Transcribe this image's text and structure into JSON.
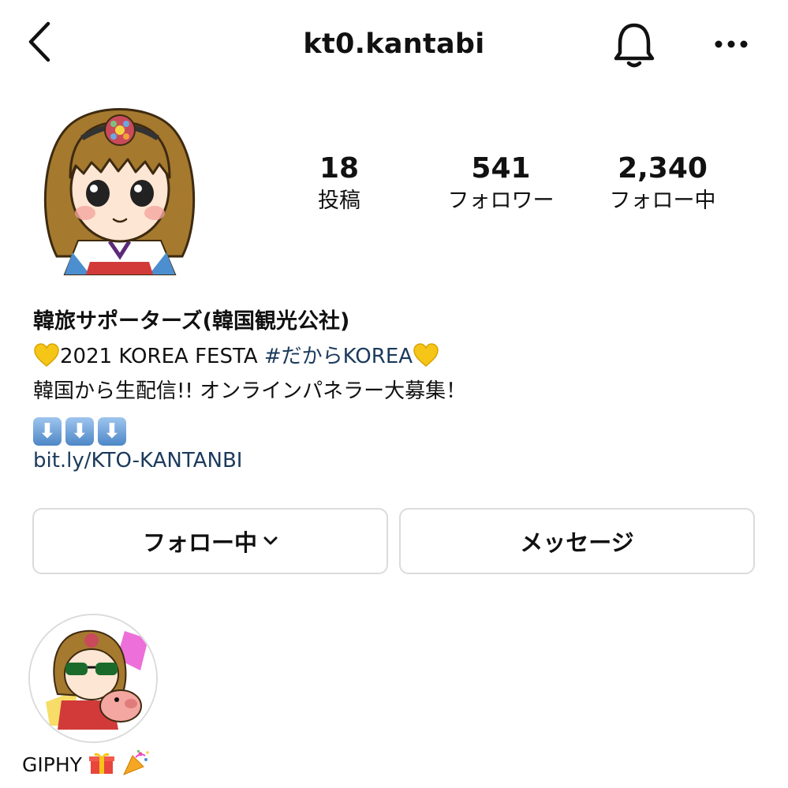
{
  "header": {
    "username": "kt0.kantabi",
    "back_icon": "chevron-left-icon",
    "bell_icon": "bell-icon",
    "more_icon": "more-horizontal-icon"
  },
  "profile": {
    "avatar_icon": "cartoon-girl-avatar"
  },
  "stats": {
    "posts": {
      "value": "18",
      "label": "投稿"
    },
    "followers": {
      "value": "541",
      "label": "フォロワー"
    },
    "following": {
      "value": "2,340",
      "label": "フォロー中"
    }
  },
  "bio": {
    "name": "韓旅サポーターズ(韓国観光公社)",
    "line1_prefix": "2021 KOREA FESTA ",
    "line1_hashtag": "#だからKOREA",
    "line2": "韓国から生配信!! オンラインパネラー大募集！",
    "link": "bit.ly/KTO-KANTANBI"
  },
  "buttons": {
    "following_label": "フォロー中",
    "message_label": "メッセージ"
  },
  "highlights": [
    {
      "label": "GIPHY"
    }
  ],
  "colors": {
    "link": "#1b3a5c",
    "border": "#dbdbdb",
    "heart": "#f5c518"
  }
}
